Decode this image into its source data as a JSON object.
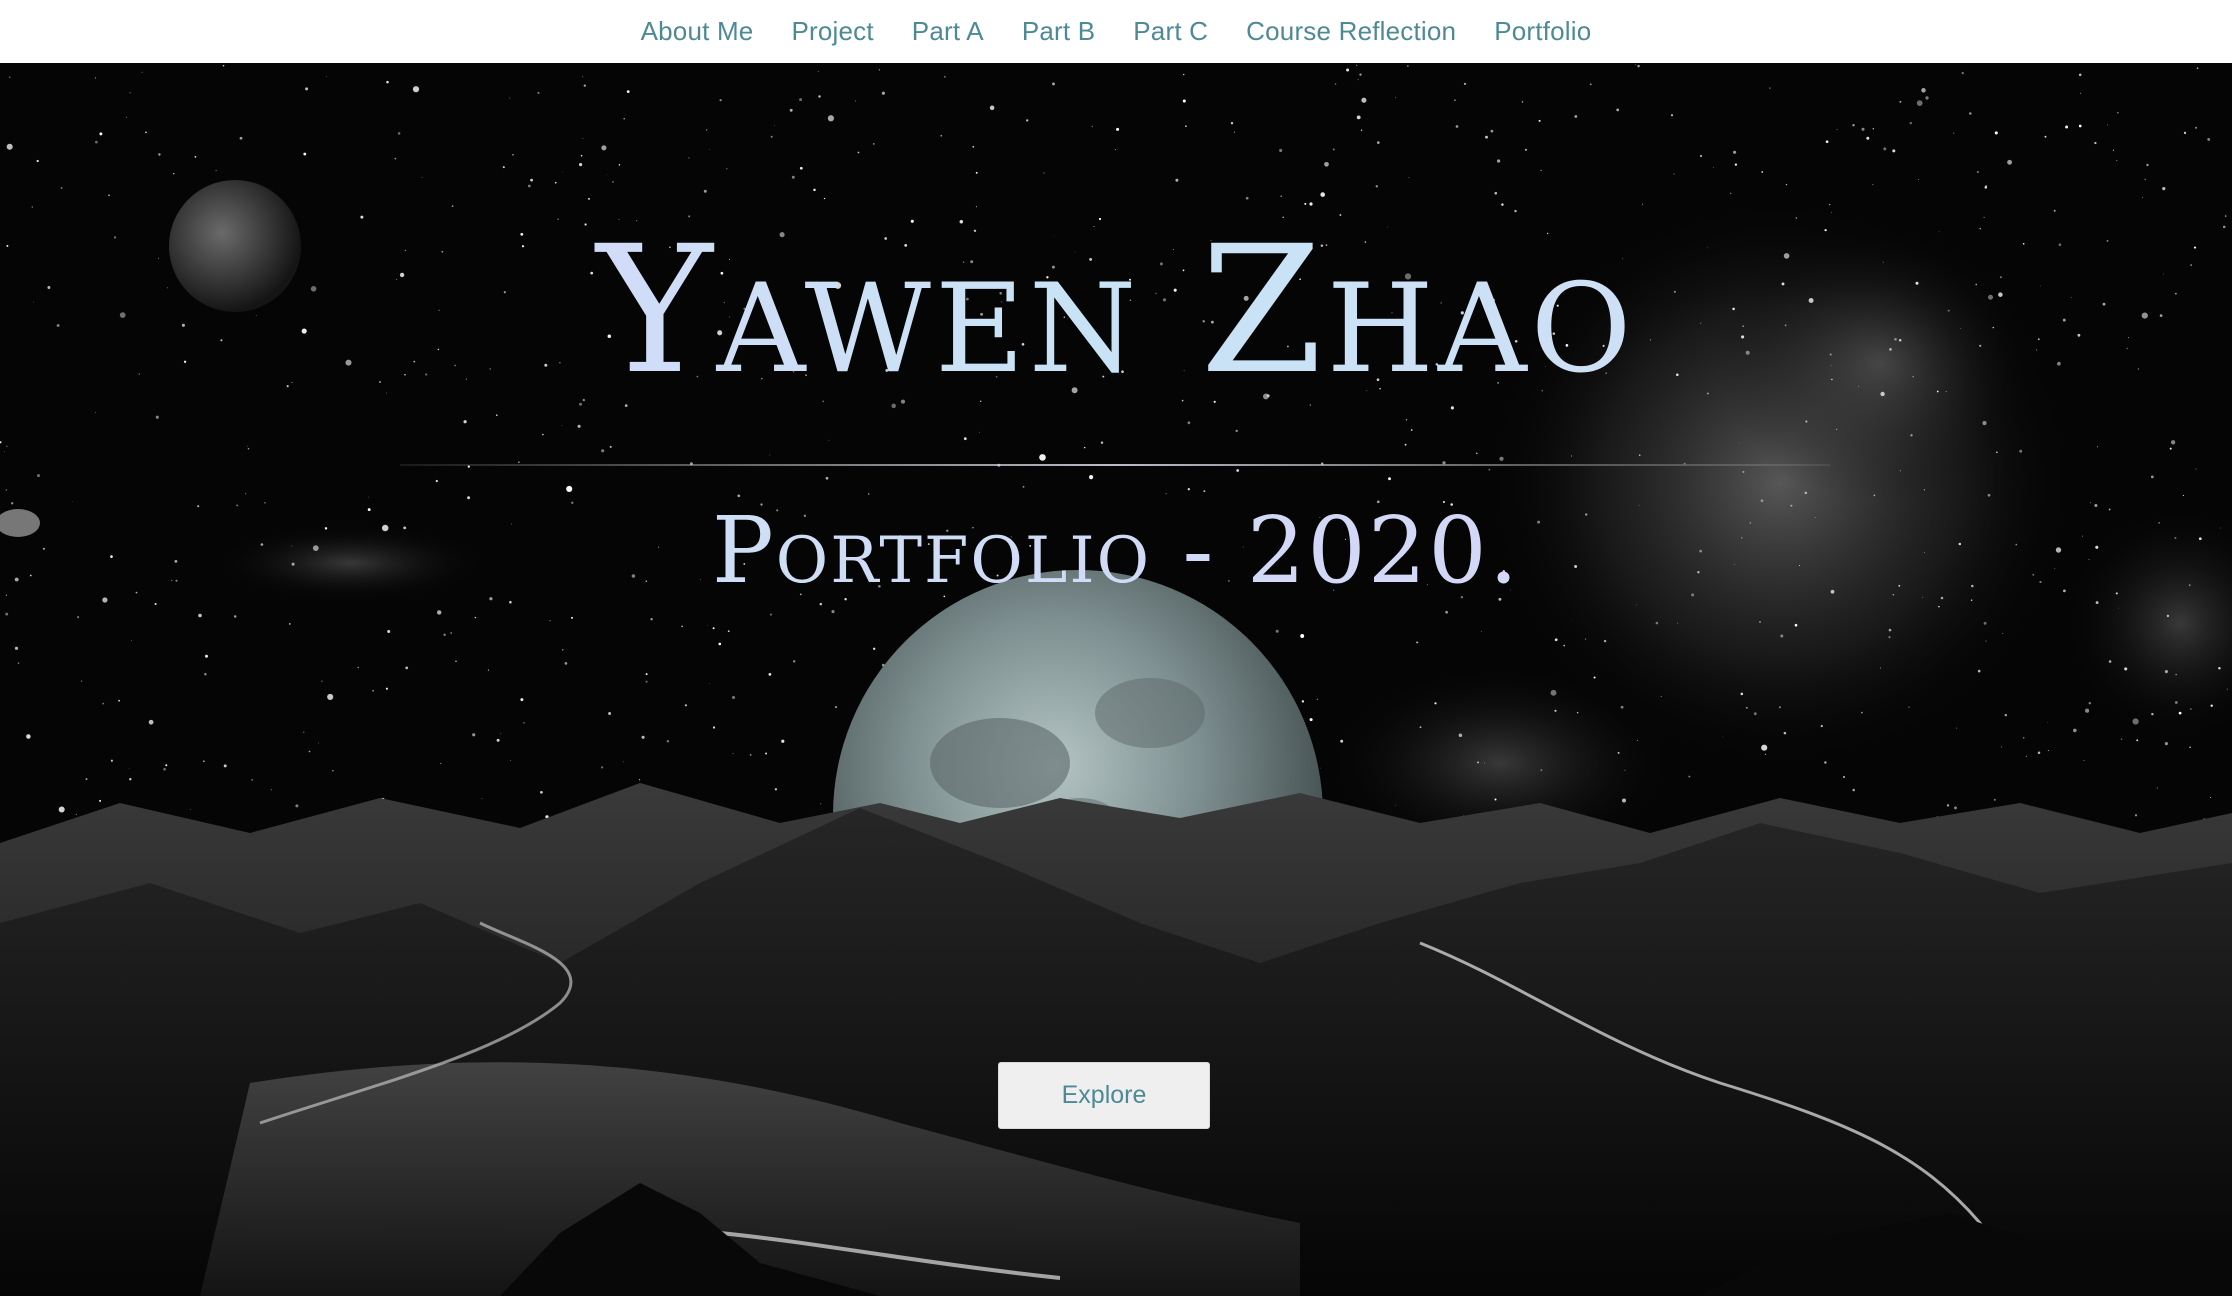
{
  "nav": {
    "items": [
      {
        "label": "About Me"
      },
      {
        "label": "Project"
      },
      {
        "label": "Part A"
      },
      {
        "label": "Part B"
      },
      {
        "label": "Part C"
      },
      {
        "label": "Course Reflection"
      },
      {
        "label": "Portfolio"
      }
    ]
  },
  "hero": {
    "title": "Yawen Zhao",
    "subtitle": "Portfolio - 2020.",
    "button_label": "Explore",
    "background_description_icon": "night-sky-moon-mountains-image"
  },
  "colors": {
    "nav_text": "#4d8a96",
    "nav_bg": "#ffffff",
    "button_bg": "#efefef",
    "title_gradient_start": "#dcd4fb",
    "title_gradient_end": "#c8e3f5"
  }
}
